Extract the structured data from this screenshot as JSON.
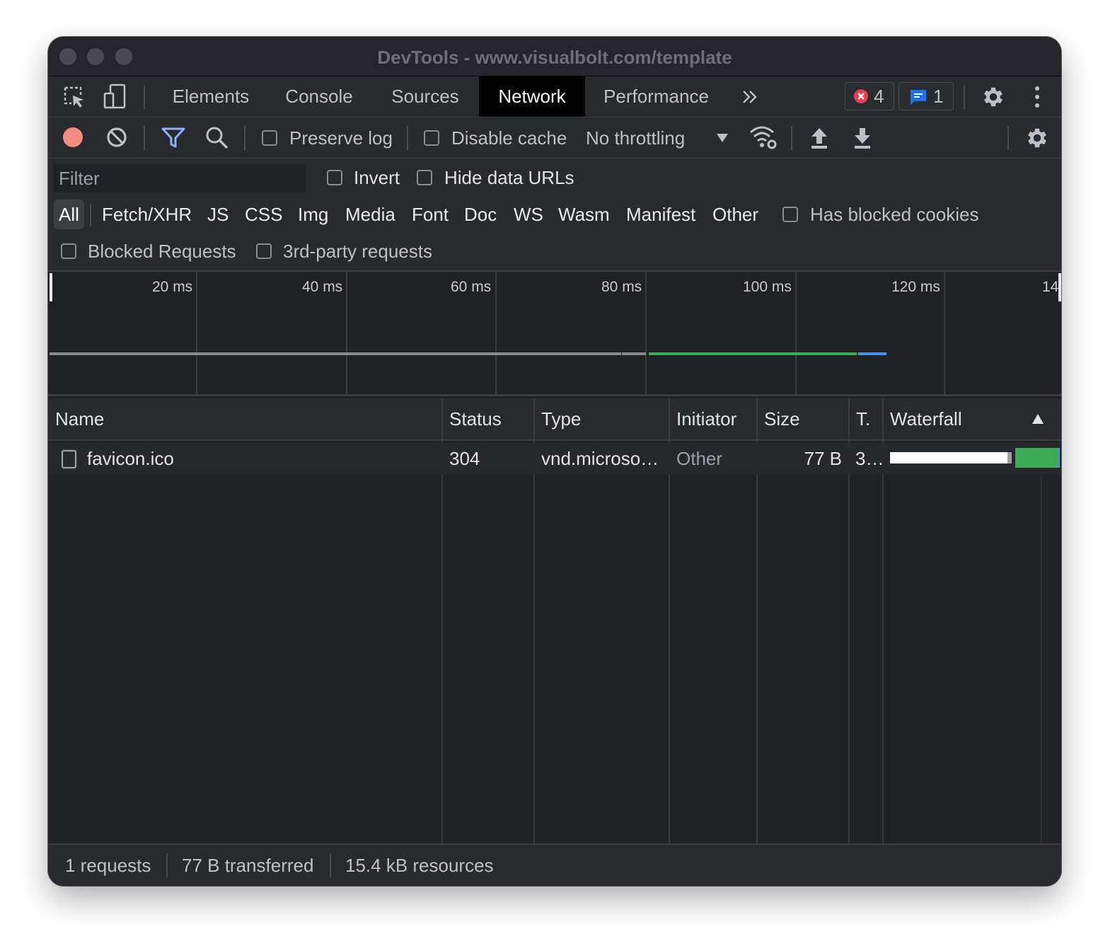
{
  "window": {
    "title": "DevTools - www.visualbolt.com/template"
  },
  "tabs": {
    "items": [
      {
        "label": "Elements"
      },
      {
        "label": "Console"
      },
      {
        "label": "Sources"
      },
      {
        "label": "Network"
      },
      {
        "label": "Performance"
      }
    ],
    "active": "Network",
    "errors_count": "4",
    "messages_count": "1"
  },
  "toolbar": {
    "preserve_log": "Preserve log",
    "disable_cache": "Disable cache",
    "throttling": "No throttling"
  },
  "filter": {
    "placeholder": "Filter",
    "invert": "Invert",
    "hide_data_urls": "Hide data URLs",
    "types": [
      "All",
      "Fetch/XHR",
      "JS",
      "CSS",
      "Img",
      "Media",
      "Font",
      "Doc",
      "WS",
      "Wasm",
      "Manifest",
      "Other"
    ],
    "active_type": "All",
    "has_blocked_cookies": "Has blocked cookies",
    "blocked_requests": "Blocked Requests",
    "third_party": "3rd-party requests"
  },
  "overview": {
    "ticks": [
      "20 ms",
      "40 ms",
      "60 ms",
      "80 ms",
      "100 ms",
      "120 ms",
      "14"
    ]
  },
  "grid": {
    "columns": [
      "Name",
      "Status",
      "Type",
      "Initiator",
      "Size",
      "T.",
      "Waterfall"
    ],
    "rows": [
      {
        "name": "favicon.ico",
        "status": "304",
        "type": "vnd.microso…",
        "initiator": "Other",
        "size": "77 B",
        "time": "3…"
      }
    ]
  },
  "status": {
    "requests": "1 requests",
    "transferred": "77 B transferred",
    "resources": "15.4 kB resources"
  },
  "colors": {
    "record": "#f28b82",
    "accent": "#8ab4f8",
    "waiting": "#3bab56",
    "download": "#4a90e2",
    "error": "#e4414c",
    "message": "#1a73e8"
  }
}
